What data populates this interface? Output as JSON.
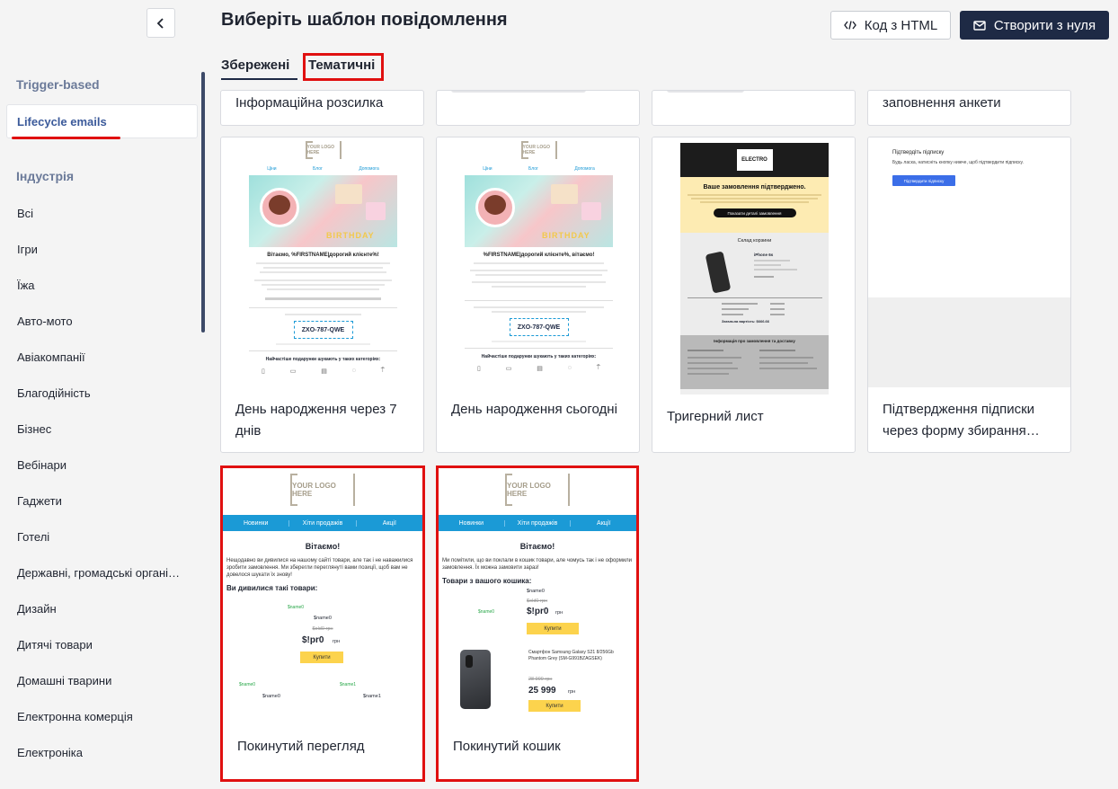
{
  "header": {
    "title": "Виберіть шаблон повідомлення",
    "html_button": "Код з HTML",
    "create_button": "Створити з нуля"
  },
  "tabs": [
    {
      "label": "Збережені",
      "active": true
    },
    {
      "label": "Тематичні",
      "active": false
    }
  ],
  "sidebar": {
    "section_trigger": "Trigger-based",
    "active_item": "Lifecycle emails",
    "section_industry": "Індустрія",
    "items": [
      "Всі",
      "Ігри",
      "Їжа",
      "Авто-мото",
      "Авіакомпанії",
      "Благодійність",
      "Бізнес",
      "Вебінари",
      "Гаджети",
      "Готелі",
      "Державні, громадські органі…",
      "Дизайн",
      "Дитячі товари",
      "Домашні тварини",
      "Електронна комерція",
      "Електроніка"
    ]
  },
  "cards_top_row": [
    "Інформаційна розсилка",
    "",
    "",
    "заповнення анкети"
  ],
  "cards": [
    {
      "title": "День народження через 7 днів"
    },
    {
      "title": "День народження сьогодні"
    },
    {
      "title": "Тригерний лист"
    },
    {
      "title": "Підтвердження підписки через форму збирання…"
    },
    {
      "title": "Покинутий перегляд"
    },
    {
      "title": "Покинутий кошик"
    }
  ],
  "previews": {
    "logo": "YOUR LOGO HERE",
    "nav_small": [
      "Ціни",
      "Блог",
      "Допомога"
    ],
    "nav": [
      "Новинки",
      "Хіти продажів",
      "Акції"
    ],
    "bday1_heading": "Вітаємо, %FIRSTNAME|дорогий клієнте%!",
    "bday2_heading": "%FIRSTNAME|дорогий клієнте%, вітаємо!",
    "promo_code": "ZXO-787-QWE",
    "categories_heading": "Найчастіше подарунки шукають у таких категоріях:",
    "birthday_word": "BIRTHDAY",
    "electro_logo": "ELECTRO",
    "electro_heading": "Ваше замовлення підтверджено.",
    "electro_button": "Показати деталі замовлення",
    "electro_cart": "Склад корзини",
    "electro_info": "Інформація про замовлення та доставку",
    "electro_product": "iPhone 6s",
    "electro_total": "Загальна вартість:   $666.66",
    "confirm_title": "Підтвердіть підписку",
    "confirm_text": "Будь ласка, натисніть кнопку нижче, щоб підтвердити підписку.",
    "confirm_button": "Підтвердити підписку",
    "browse_greeting": "Вітаємо!",
    "browse_text": "Нещодавно ви дивилися на нашому сайті товари, але так і не наважилися зробити замовлення. Ми зберегли переглянуті вами позиції, щоб вам не довелося шукати їх знову!",
    "browse_subheading": "Ви дивилися такі товари:",
    "cart_greeting": "Вітаємо!",
    "cart_text": "Ми помітили, що ви поклали в кошик товари, але чомусь так і не оформили замовлення. Їх можна замовити зараз!",
    "cart_subheading": "Товари з вашого кошика:",
    "name0": "$name0",
    "name1": "$name1",
    "old_price": "$old0 грн",
    "price": "$!pr0",
    "currency": "грн",
    "buy": "Купити",
    "phone_name": "Смартфон Samsung Galaxy S21 8/256Gb Phantom Grey (SM-G991BZAGSEK)",
    "phone_old_price": "28 999 грн",
    "phone_price": "25 999",
    "link_name0": "$name0",
    "link_name1": "$name1"
  }
}
